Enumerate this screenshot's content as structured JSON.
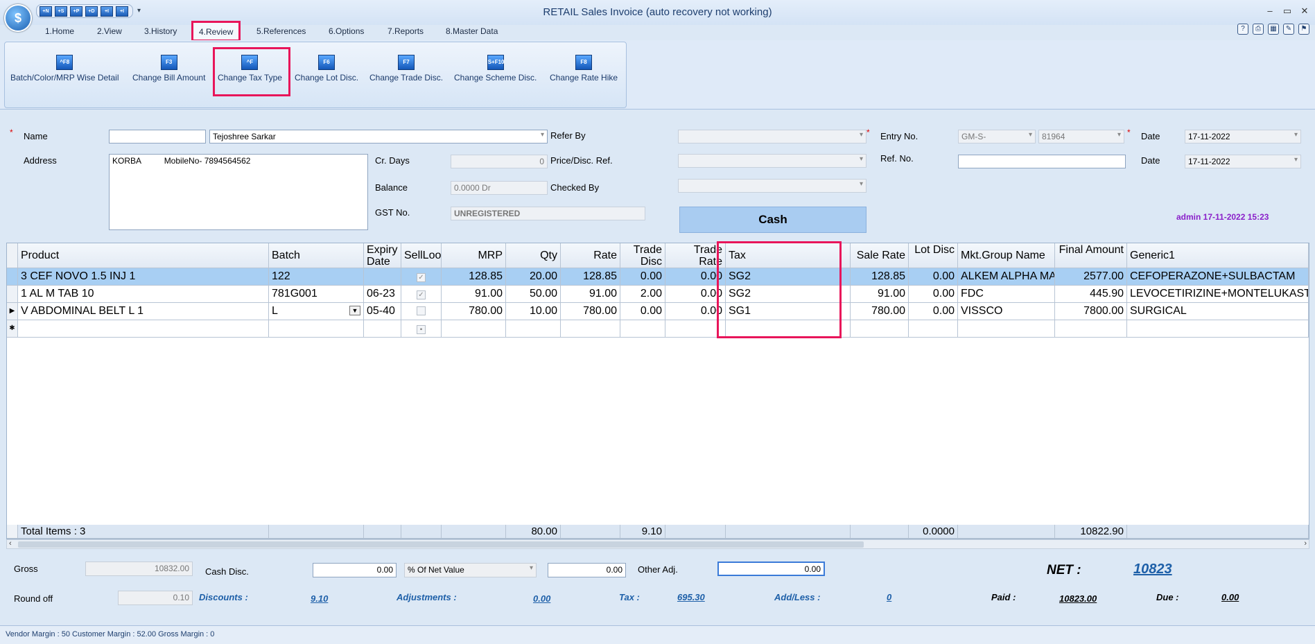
{
  "app": {
    "title": "RETAIL Sales Invoice (auto recovery not working)",
    "logo_text": "$"
  },
  "quick_access": [
    "+N",
    "+S",
    "+P",
    "+D",
    "+I",
    "+I"
  ],
  "window_controls": {
    "minimize": "–",
    "maximize": "▭",
    "close": "✕"
  },
  "menu_tabs": [
    "1.Home",
    "2.View",
    "3.History",
    "4.Review",
    "5.References",
    "6.Options",
    "7.Reports",
    "8.Master Data"
  ],
  "ribbon": {
    "buttons": [
      {
        "label": "Batch/Color/MRP Wise Detail",
        "key": "^F8"
      },
      {
        "label": "Change Bill Amount",
        "key": "F3"
      },
      {
        "label": "Change Tax Type",
        "key": "^F"
      },
      {
        "label": "Change Lot Disc.",
        "key": "F6"
      },
      {
        "label": "Change Trade Disc.",
        "key": "F7"
      },
      {
        "label": "Change Scheme Disc.",
        "key": "S+F10"
      },
      {
        "label": "Change Rate Hike",
        "key": "F8"
      }
    ]
  },
  "form": {
    "name_label": "Name",
    "name_code": "",
    "name_value": "Tejoshree Sarkar",
    "address_label": "Address",
    "address_value": "KORBA          MobileNo- 7894564562",
    "cr_days_label": "Cr. Days",
    "cr_days_value": "0",
    "balance_label": "Balance",
    "balance_value": "0.0000 Dr",
    "gst_label": "GST No.",
    "gst_value": "UNREGISTERED",
    "refer_by_label": "Refer By",
    "price_ref_label": "Price/Disc. Ref.",
    "checked_by_label": "Checked By",
    "entry_no_label": "Entry No.",
    "entry_series": "GM-S-",
    "entry_no": "81964",
    "ref_no_label": "Ref. No.",
    "date_label": "Date",
    "date1": "17-11-2022",
    "date2": "17-11-2022",
    "cash_label": "Cash",
    "admin_text": "admin 17-11-2022 15:23"
  },
  "grid": {
    "headers": [
      "Product",
      "Batch",
      "Expiry Date",
      "SellLoo",
      "MRP",
      "Qty",
      "Rate",
      "Trade Disc",
      "Trade Rate",
      "Tax",
      "Sale Rate",
      "Lot Disc",
      "Mkt.Group Name",
      "Final Amount",
      "Generic1"
    ],
    "rows": [
      {
        "product": "3 CEF NOVO 1.5 INJ 1",
        "batch": "122",
        "expiry": "",
        "mrp": "128.85",
        "qty": "20.00",
        "rate": "128.85",
        "trade_disc": "0.00",
        "trade_rate": "0.00",
        "tax": "SG2",
        "sale_rate": "128.85",
        "lot_disc": "0.00",
        "mkt_group": "ALKEM ALPHA MA",
        "final_amount": "2577.00",
        "generic": "CEFOPERAZONE+SULBACTAM"
      },
      {
        "product": "1 AL M TAB 10",
        "batch": "781G001",
        "expiry": "06-23",
        "mrp": "91.00",
        "qty": "50.00",
        "rate": "91.00",
        "trade_disc": "2.00",
        "trade_rate": "0.00",
        "tax": "SG2",
        "sale_rate": "91.00",
        "lot_disc": "0.00",
        "mkt_group": "FDC",
        "final_amount": "445.90",
        "generic": "LEVOCETIRIZINE+MONTELUKAST"
      },
      {
        "product": "V ABDOMINAL BELT L 1",
        "batch": "L",
        "expiry": "05-40",
        "mrp": "780.00",
        "qty": "10.00",
        "rate": "780.00",
        "trade_disc": "0.00",
        "trade_rate": "0.00",
        "tax": "SG1",
        "sale_rate": "780.00",
        "lot_disc": "0.00",
        "mkt_group": "VISSCO",
        "final_amount": "7800.00",
        "generic": "SURGICAL"
      }
    ],
    "totals": {
      "label": "Total Items : 3",
      "qty": "80.00",
      "trade_disc": "9.10",
      "lot_disc": "0.0000",
      "final_amount": "10822.90"
    }
  },
  "footer": {
    "gross_label": "Gross",
    "gross_value": "10832.00",
    "cash_disc_label": "Cash Disc.",
    "cash_disc_value": "0.00",
    "cash_disc_mode": "% Of Net Value",
    "cash_disc_amount": "0.00",
    "other_adj_label": "Other Adj.",
    "other_adj_value": "0.00",
    "net_label": "NET :",
    "net_value": "10823",
    "round_off_label": "Round off",
    "round_off_value": "0.10",
    "discounts_label": "Discounts :",
    "discounts_value": "9.10",
    "adjustments_label": "Adjustments :",
    "adjustments_value": "0.00",
    "tax_label": "Tax :",
    "tax_value": "695.30",
    "addless_label": "Add/Less :",
    "addless_value": "0",
    "paid_label": "Paid :",
    "paid_value": "10823.00",
    "due_label": "Due :",
    "due_value": "0.00"
  },
  "status_bar": "Vendor Margin : 50 Customer Margin : 52.00 Gross Margin : 0"
}
